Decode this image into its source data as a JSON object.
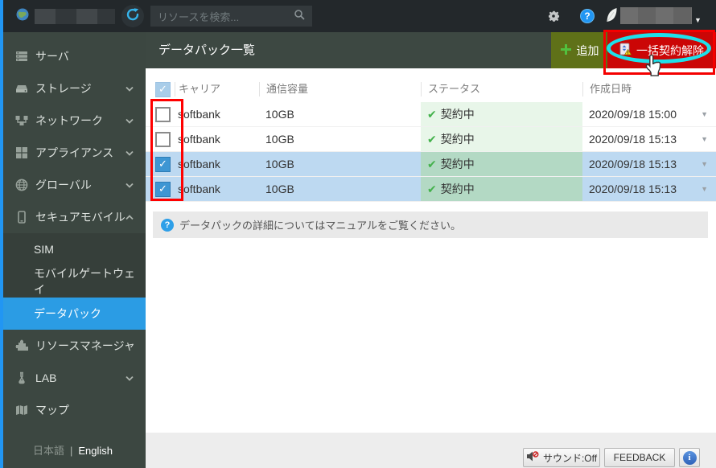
{
  "topbar": {
    "search_placeholder": "リソースを検索..."
  },
  "icons": {
    "caret_down": "▼",
    "check": "✓",
    "status_check": "✔",
    "question": "?",
    "info": "i",
    "plus": "+"
  },
  "sidebar": {
    "items": [
      {
        "label": "サーバ"
      },
      {
        "label": "ストレージ"
      },
      {
        "label": "ネットワーク"
      },
      {
        "label": "アプライアンス"
      },
      {
        "label": "グローバル"
      },
      {
        "label": "セキュアモバイル"
      }
    ],
    "submenu": [
      {
        "label": "SIM"
      },
      {
        "label": "モバイルゲートウェイ"
      },
      {
        "label": "データパック",
        "selected": true
      }
    ],
    "items_bottom": [
      {
        "label": "リソースマネージャ"
      },
      {
        "label": "LAB"
      },
      {
        "label": "マップ"
      }
    ],
    "language": {
      "ja": "日本語",
      "divider": "|",
      "en": "English"
    }
  },
  "header": {
    "title": "データパック一覧",
    "add_label": "追加",
    "bulk_release_label": "一括契約解除"
  },
  "table": {
    "columns": [
      "キャリア",
      "通信容量",
      "ステータス",
      "作成日時"
    ],
    "rows": [
      {
        "carrier": "softbank",
        "capacity": "10GB",
        "status": "契約中",
        "created": "2020/09/18 15:00",
        "checked": false
      },
      {
        "carrier": "softbank",
        "capacity": "10GB",
        "status": "契約中",
        "created": "2020/09/18 15:13",
        "checked": false
      },
      {
        "carrier": "softbank",
        "capacity": "10GB",
        "status": "契約中",
        "created": "2020/09/18 15:13",
        "checked": true
      },
      {
        "carrier": "softbank",
        "capacity": "10GB",
        "status": "契約中",
        "created": "2020/09/18 15:13",
        "checked": true
      }
    ]
  },
  "info_bar": {
    "text": "データパックの詳細についてはマニュアルをご覧ください。"
  },
  "footer": {
    "sound_label": "サウンド:Off",
    "feedback_label": "FEEDBACK"
  },
  "colors": {
    "topbar_bg": "#23282b",
    "sidebar_bg": "#3c4741",
    "selected_menu": "#2b9ce4",
    "header_bg": "#3d4842",
    "add_button_bg": "#5f7118",
    "danger_button_bg": "#cb0606",
    "status_ok_bg": "#e8f6e9",
    "status_ok_selected_bg": "#b3d9c4",
    "row_selected_bg": "#bdd9f1",
    "annotation_red": "#ff0000",
    "annotation_cyan": "#1ee0ea"
  }
}
